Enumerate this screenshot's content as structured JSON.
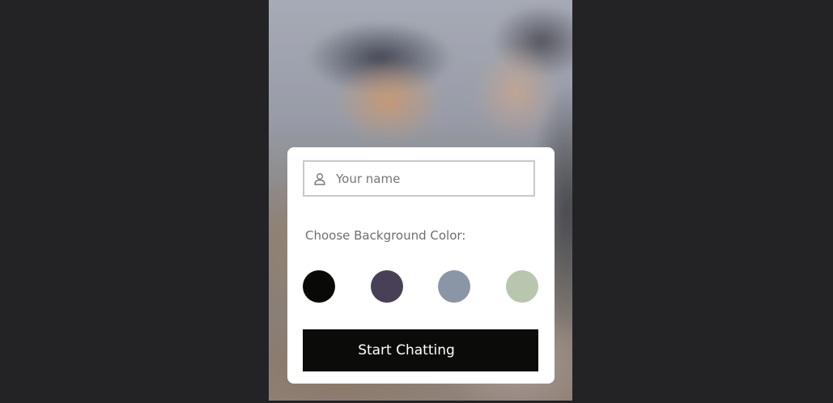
{
  "start_screen": {
    "name_input": {
      "placeholder": "Your name",
      "value": "",
      "icon": "user-icon"
    },
    "choose_label": "Choose Background Color:",
    "colors": [
      {
        "name": "black",
        "hex": "#090a08"
      },
      {
        "name": "purple",
        "hex": "#474056"
      },
      {
        "name": "grey",
        "hex": "#8a95a5"
      },
      {
        "name": "green",
        "hex": "#b9c6ae"
      }
    ],
    "start_button_label": "Start Chatting"
  }
}
